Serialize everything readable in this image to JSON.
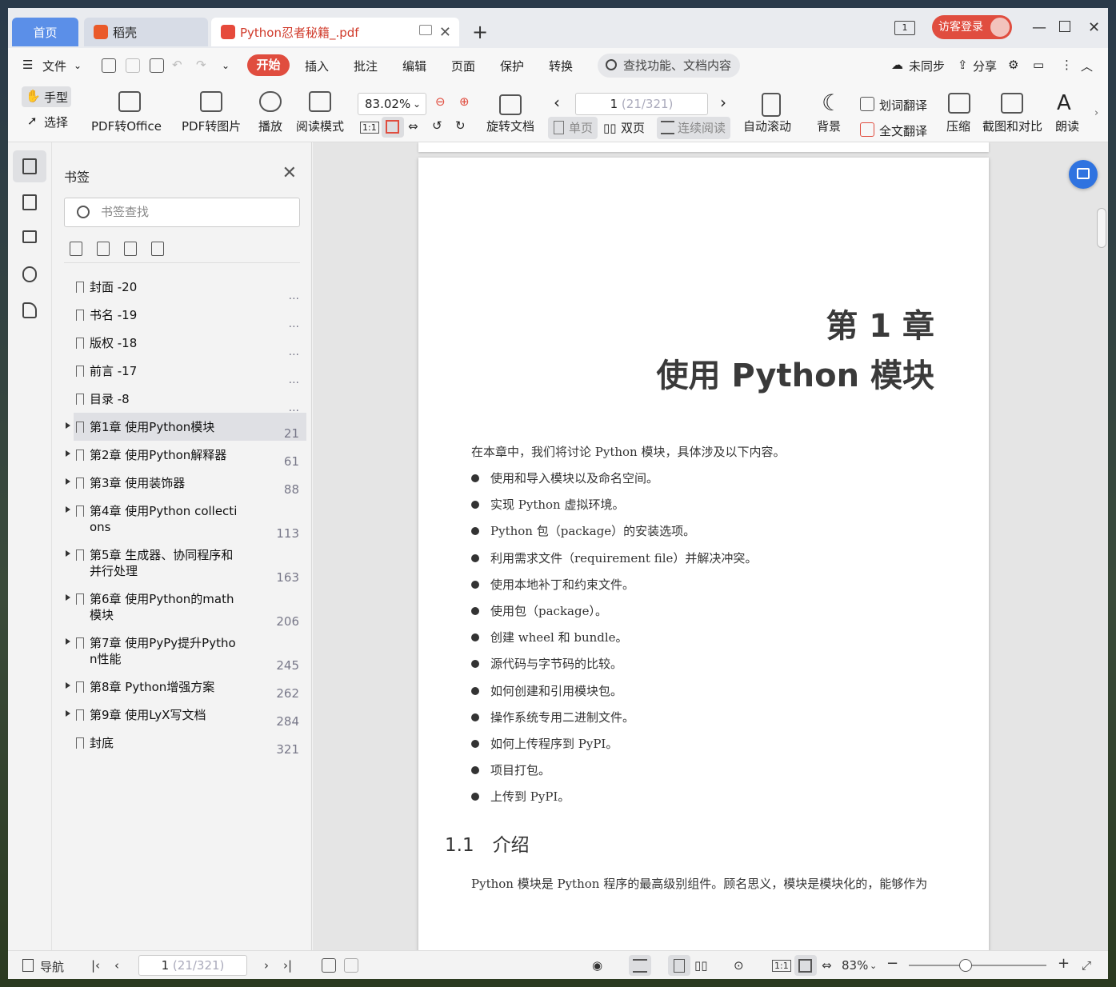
{
  "tabs": {
    "home": "首页",
    "daoke": "稻壳",
    "document": "Python忍者秘籍_.pdf"
  },
  "titlebar": {
    "page_count_icon": "1",
    "login": "访客登录"
  },
  "menu": {
    "file": "文件",
    "start": "开始",
    "insert": "插入",
    "annotate": "批注",
    "edit": "编辑",
    "page": "页面",
    "protect": "保护",
    "convert": "转换",
    "search_placeholder": "查找功能、文档内容",
    "sync": "未同步",
    "share": "分享"
  },
  "ribbon": {
    "hand": "手型",
    "select": "选择",
    "pdf_to_office": "PDF转Office",
    "pdf_to_image": "PDF转图片",
    "play": "播放",
    "read_mode": "阅读模式",
    "zoom": "83.02%",
    "rotate_doc": "旋转文档",
    "page_current": "1",
    "page_total": "(21/321)",
    "single": "单页",
    "double": "双页",
    "continuous": "连续阅读",
    "auto_scroll": "自动滚动",
    "background": "背景",
    "word_translate": "划词翻译",
    "full_translate": "全文翻译",
    "compress": "压缩",
    "screenshot_compare": "截图和对比",
    "read_aloud": "朗读"
  },
  "bookmarks": {
    "title": "书签",
    "search_placeholder": "书签查找",
    "items": [
      {
        "title": "封面 -20",
        "page": "...",
        "expandable": false
      },
      {
        "title": "书名 -19",
        "page": "...",
        "expandable": false
      },
      {
        "title": "版权 -18",
        "page": "...",
        "expandable": false
      },
      {
        "title": "前言 -17",
        "page": "...",
        "expandable": false
      },
      {
        "title": "目录 -8",
        "page": "...",
        "expandable": false
      },
      {
        "title": "第1章 使用Python模块",
        "page": "21",
        "expandable": true,
        "selected": true
      },
      {
        "title": "第2章 使用Python解释器",
        "page": "61",
        "expandable": true
      },
      {
        "title": "第3章 使用装饰器",
        "page": "88",
        "expandable": true
      },
      {
        "title": "第4章 使用Python collections",
        "page": "113",
        "expandable": true
      },
      {
        "title": "第5章 生成器、协同程序和并行处理",
        "page": "163",
        "expandable": true
      },
      {
        "title": "第6章 使用Python的math模块",
        "page": "206",
        "expandable": true
      },
      {
        "title": "第7章 使用PyPy提升Python性能",
        "page": "245",
        "expandable": true
      },
      {
        "title": "第8章 Python增强方案",
        "page": "262",
        "expandable": true
      },
      {
        "title": "第9章 使用LyX写文档",
        "page": "284",
        "expandable": true
      },
      {
        "title": "封底",
        "page": "321",
        "expandable": false
      }
    ]
  },
  "page": {
    "chapter_number": "第 1 章",
    "chapter_title": "使用 Python 模块",
    "intro": "在本章中，我们将讨论 Python 模块，具体涉及以下内容。",
    "bullets": [
      "使用和导入模块以及命名空间。",
      "实现 Python 虚拟环境。",
      "Python 包（package）的安装选项。",
      "利用需求文件（requirement file）并解决冲突。",
      "使用本地补丁和约束文件。",
      "使用包（package）。",
      "创建 wheel 和 bundle。",
      "源代码与字节码的比较。",
      "如何创建和引用模块包。",
      "操作系统专用二进制文件。",
      "如何上传程序到 PyPI。",
      "项目打包。",
      "上传到 PyPI。"
    ],
    "section": "1.1　介绍",
    "paragraph": "Python 模块是 Python 程序的最高级别组件。顾名思义，模块是模块化的，能够作为"
  },
  "statusbar": {
    "nav": "导航",
    "page_current": "1",
    "page_total": "(21/321)",
    "zoom": "83%"
  },
  "colors": {
    "accent_red": "#e04d3f",
    "home_tab": "#5b8fe8",
    "float_button": "#2f73e0"
  }
}
